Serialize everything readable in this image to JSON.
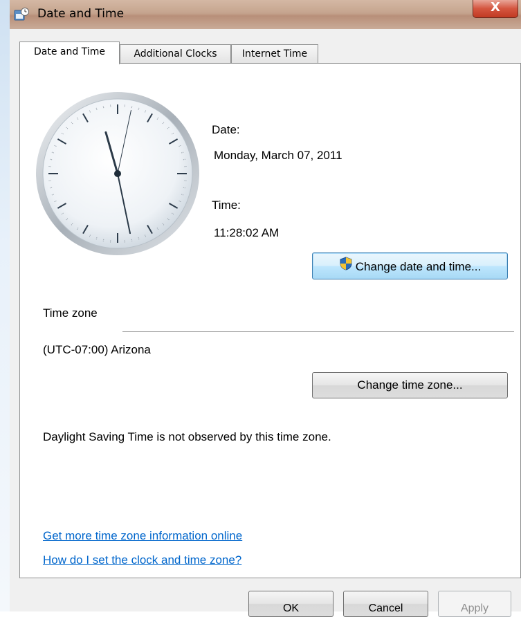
{
  "window": {
    "title": "Date and Time",
    "close_label": "X"
  },
  "tabs": [
    {
      "label": "Date and Time",
      "active": true
    },
    {
      "label": "Additional Clocks",
      "active": false
    },
    {
      "label": "Internet Time",
      "active": false
    }
  ],
  "clock": {
    "hour": 11,
    "minute": 28,
    "second": 2
  },
  "date": {
    "label": "Date:",
    "value": "Monday, March 07, 2011"
  },
  "time": {
    "label": "Time:",
    "value": "11:28:02 AM"
  },
  "buttons": {
    "change_date_time": "Change date and time...",
    "change_time_zone": "Change time zone...",
    "ok": "OK",
    "cancel": "Cancel",
    "apply": "Apply"
  },
  "timezone": {
    "section_label": "Time zone",
    "value": "(UTC-07:00) Arizona",
    "dst_note": "Daylight Saving Time is not observed by this time zone."
  },
  "links": {
    "more_info": "Get more time zone information online",
    "how_to": "How do I set the clock and time zone?"
  },
  "colors": {
    "link": "#0066cc",
    "close_button": "#c13b23",
    "focus_border": "#3c7fb1"
  }
}
